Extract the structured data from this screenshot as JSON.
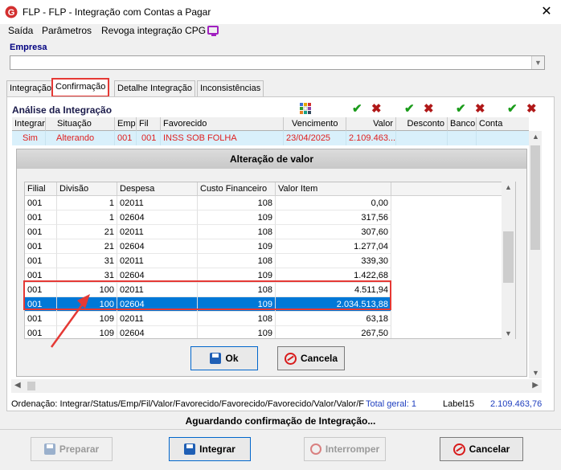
{
  "window": {
    "title": "FLP -  FLP - Integração com Contas a Pagar"
  },
  "menu": [
    {
      "label": "Saída"
    },
    {
      "label": "Parâmetros"
    },
    {
      "label": "Revoga integração CPG"
    }
  ],
  "empresa": {
    "label": "Empresa",
    "value": ""
  },
  "tabs": [
    {
      "label": "Integração",
      "active": false
    },
    {
      "label": "Confirmação",
      "active": true
    },
    {
      "label": "Detalhe Integração",
      "active": false
    },
    {
      "label": "Inconsistências",
      "active": false
    }
  ],
  "analise": {
    "title": "Análise da Integração",
    "columns": [
      "Integrar",
      "Situação",
      "Emp",
      "Fil",
      "Favorecido",
      "Vencimento",
      "Valor",
      "Desconto",
      "Banco",
      "Conta"
    ],
    "row": {
      "integrar": "Sim",
      "situacao": "Alterando",
      "emp": "001",
      "fil": "001",
      "favorecido": "INSS SOB FOLHA",
      "vencimento": "23/04/2025",
      "valor": "2.109.463...",
      "desconto": "",
      "banco": "",
      "conta": ""
    }
  },
  "dialog": {
    "title": "Alteração de valor",
    "columns": [
      "Filial",
      "Divisão",
      "Despesa",
      "Custo Financeiro",
      "Valor Item"
    ],
    "rows": [
      {
        "filial": "001",
        "divisao": "1",
        "despesa": "02011",
        "custo": "108",
        "valor": "0,00",
        "selected": false
      },
      {
        "filial": "001",
        "divisao": "1",
        "despesa": "02604",
        "custo": "109",
        "valor": "317,56",
        "selected": false
      },
      {
        "filial": "001",
        "divisao": "21",
        "despesa": "02011",
        "custo": "108",
        "valor": "307,60",
        "selected": false
      },
      {
        "filial": "001",
        "divisao": "21",
        "despesa": "02604",
        "custo": "109",
        "valor": "1.277,04",
        "selected": false
      },
      {
        "filial": "001",
        "divisao": "31",
        "despesa": "02011",
        "custo": "108",
        "valor": "339,30",
        "selected": false
      },
      {
        "filial": "001",
        "divisao": "31",
        "despesa": "02604",
        "custo": "109",
        "valor": "1.422,68",
        "selected": false
      },
      {
        "filial": "001",
        "divisao": "100",
        "despesa": "02011",
        "custo": "108",
        "valor": "4.511,94",
        "selected": false
      },
      {
        "filial": "001",
        "divisao": "100",
        "despesa": "02604",
        "custo": "109",
        "valor": "2.034.513,88",
        "selected": true
      },
      {
        "filial": "001",
        "divisao": "109",
        "despesa": "02011",
        "custo": "108",
        "valor": "63,18",
        "selected": false
      },
      {
        "filial": "001",
        "divisao": "109",
        "despesa": "02604",
        "custo": "109",
        "valor": "267,50",
        "selected": false
      }
    ],
    "ok_label": "Ok",
    "cancel_label": "Cancela"
  },
  "status": {
    "ordenacao": "Ordenação: Integrar/Status/Emp/Fil/Valor/Favorecido/Favorecido/Favorecido/Valor/Valor/F",
    "total_geral": "Total geral: 1",
    "label15": "Label15",
    "total_valor": "2.109.463,76"
  },
  "footer_message": "Aguardando confirmação de Integração...",
  "buttons": {
    "preparar": "Preparar",
    "integrar": "Integrar",
    "interromper": "Interromper",
    "cancelar": "Cancelar"
  },
  "colors": {
    "highlight": "#e53935",
    "selection": "#0078d7",
    "row_text": "#e02020",
    "check": "#1a9b1a",
    "cross": "#b01818"
  }
}
